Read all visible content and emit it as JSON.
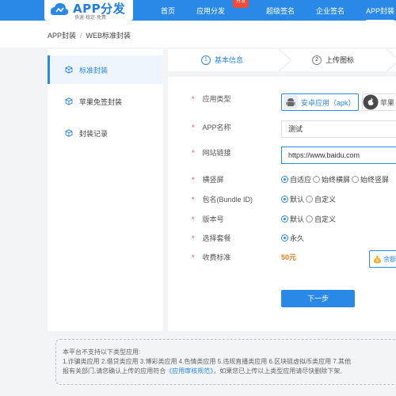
{
  "logo": {
    "title": "APP分发",
    "tagline": "快速·稳定·免费"
  },
  "nav": {
    "items": [
      {
        "label": "首页"
      },
      {
        "label": "应用分发"
      },
      {
        "label": "超级签名"
      },
      {
        "label": "企业签名"
      },
      {
        "label": "APP封装"
      }
    ],
    "hot_badge": "分发",
    "active_index": 4
  },
  "breadcrumb": {
    "parent": "APP封装",
    "separator": "/",
    "current": "WEB标准封装"
  },
  "sidebar": {
    "items": [
      {
        "label": "标准封装",
        "icon": "cube-icon"
      },
      {
        "label": "苹果免签封装",
        "icon": "cube-icon"
      },
      {
        "label": "封装记录",
        "icon": "cube-icon"
      }
    ]
  },
  "steps": [
    {
      "num": "1",
      "label": "基本信息"
    },
    {
      "num": "2",
      "label": "上传图标"
    }
  ],
  "form": {
    "required_mark": "*",
    "app_type": {
      "label": "应用类型",
      "options": [
        {
          "label": "安卓应用（apk）",
          "icon": "android-icon"
        },
        {
          "label": "苹果",
          "icon": "apple-icon"
        }
      ]
    },
    "app_name": {
      "label": "APP名称",
      "value": "测试"
    },
    "website": {
      "label": "网站链接",
      "value": "https://www.baidu.com"
    },
    "orientation": {
      "label": "横竖屏",
      "options": [
        "自适应",
        "始终横屏",
        "始终竖屏"
      ],
      "selected": 0
    },
    "bundle_id": {
      "label": "包名(Bundle ID)",
      "options": [
        "默认",
        "自定义"
      ],
      "selected": 0
    },
    "version": {
      "label": "版本号",
      "options": [
        "默认",
        "自定义"
      ],
      "selected": 0
    },
    "package": {
      "label": "选择套餐",
      "options": [
        "永久"
      ],
      "selected": 0
    },
    "fee": {
      "label": "收费标准",
      "value": "50元",
      "balance_label": "余额"
    },
    "next_button": "下一步"
  },
  "notice": {
    "title": "本平台不支持以下类型应用:",
    "line1": "1.诈骗类应用 2.借贷类应用 3.博彩类应用 4.色情类应用 5.违规直播类应用 6.区块链虚拟币类应用 7.其他",
    "line2_pre": "报有关部门,请您确认上传的应用符合",
    "line2_link": "《应用审核规范》",
    "line2_post": "，如果您已上传以上类型应用请尽快删除下架,"
  },
  "colors": {
    "primary": "#2a89e6",
    "required": "#e74c3c",
    "price": "#e67e22",
    "hot": "#f04b3a"
  }
}
